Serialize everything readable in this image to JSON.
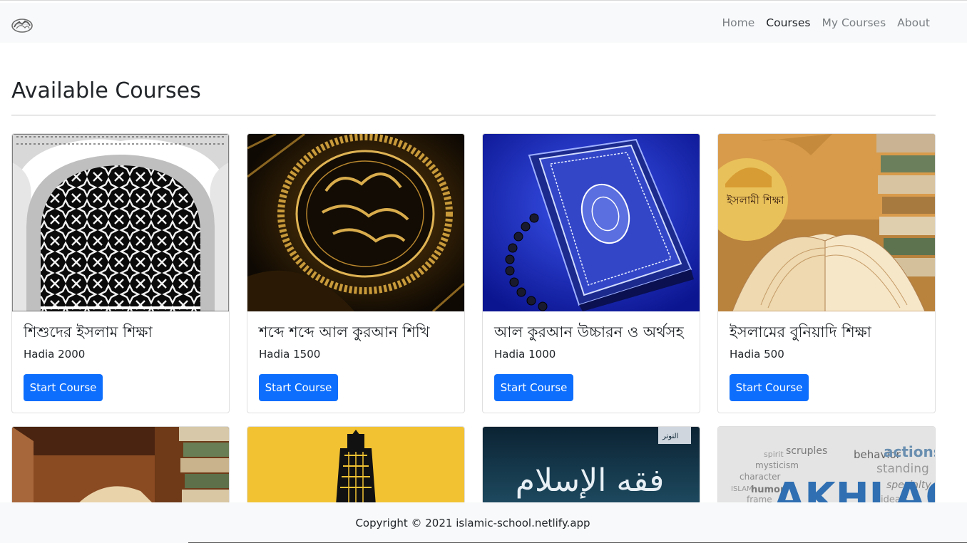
{
  "nav": {
    "logo_icon": "quran-calligraphy-logo-icon",
    "links": [
      "Home",
      "Courses",
      "My Courses",
      "About"
    ],
    "active": "Courses"
  },
  "page": {
    "title": "Available Courses"
  },
  "courses": [
    {
      "title": "শিশুদের ইসলাম শিক্ষা",
      "price": "Hadia 2000",
      "button": "Start Course",
      "image": "islamic-pattern-arch"
    },
    {
      "title": "শব্দে শব্দে আল কুরআন শিখি",
      "price": "Hadia 1500",
      "button": "Start Course",
      "image": "golden-quran-cover"
    },
    {
      "title": "আল কুরআন উচ্চারন ও অর্থসহ",
      "price": "Hadia 1000",
      "button": "Start Course",
      "image": "blue-quran-with-tasbih"
    },
    {
      "title": "ইসলামের বুনিয়াদি শিক্ষা",
      "price": "Hadia 500",
      "button": "Start Course",
      "image": "open-books-islamic-shiksha"
    }
  ],
  "image_text": {
    "islami_shiksha": "ইসলামী শিক্ষা",
    "fiqh": "فقه الإسلام",
    "words": [
      "scruples",
      "behavior",
      "actions",
      "spirit",
      "mysticism",
      "standing",
      "character",
      "humor",
      "specialty",
      "ISLAM",
      "frame",
      "ideals",
      "AKHLAQ"
    ]
  },
  "footer": {
    "text": "Copyright © 2021 islamic-school.netlify.app"
  },
  "colors": {
    "primary": "#0d6efd",
    "navbar_bg": "#f8f9fa"
  }
}
